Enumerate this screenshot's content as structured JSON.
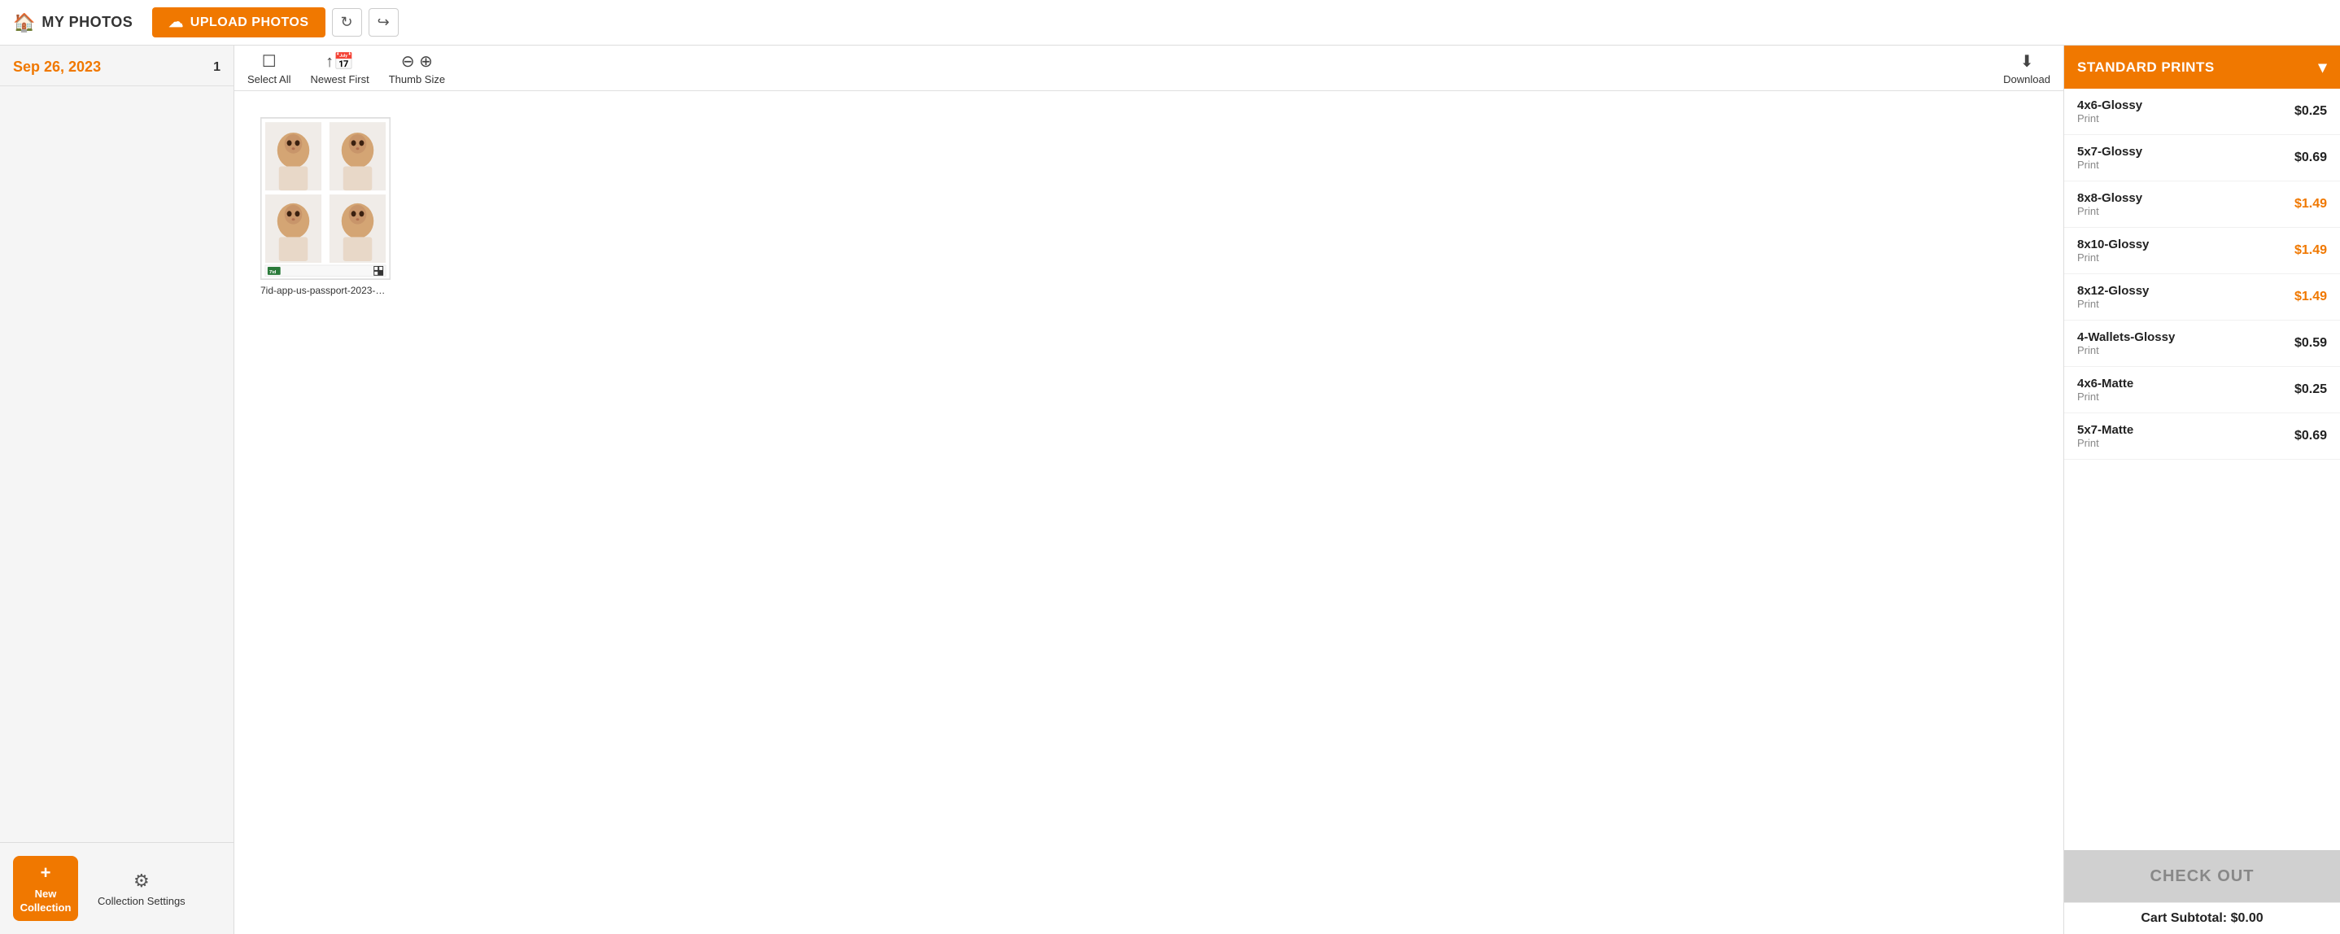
{
  "topbar": {
    "my_photos_label": "MY PHOTOS",
    "upload_btn_label": "UPLOAD PHOTOS",
    "refresh_icon": "↻",
    "share_icon": "↪"
  },
  "sidebar": {
    "date": "Sep 26, 2023",
    "count": "1",
    "new_collection_plus": "+",
    "new_collection_label": "New Collection",
    "collection_settings_label": "Collection Settings"
  },
  "toolbar": {
    "select_all_label": "Select All",
    "newest_first_label": "Newest First",
    "thumb_size_label": "Thumb Size",
    "download_label": "Download"
  },
  "photo": {
    "filename": "7id-app-us-passport-2023-09..."
  },
  "right_panel": {
    "standard_prints_label": "STANDARD PRINTS",
    "prints": [
      {
        "name": "4x6-Glossy",
        "type": "Print",
        "price": "$0.25",
        "highlight": false
      },
      {
        "name": "5x7-Glossy",
        "type": "Print",
        "price": "$0.69",
        "highlight": false
      },
      {
        "name": "8x8-Glossy",
        "type": "Print",
        "price": "$1.49",
        "highlight": true
      },
      {
        "name": "8x10-Glossy",
        "type": "Print",
        "price": "$1.49",
        "highlight": true
      },
      {
        "name": "8x12-Glossy",
        "type": "Print",
        "price": "$1.49",
        "highlight": true
      },
      {
        "name": "4-Wallets-Glossy",
        "type": "Print",
        "price": "$0.59",
        "highlight": false
      },
      {
        "name": "4x6-Matte",
        "type": "Print",
        "price": "$0.25",
        "highlight": false
      },
      {
        "name": "5x7-Matte",
        "type": "Print",
        "price": "$0.69",
        "highlight": false
      }
    ],
    "checkout_label": "CHECK OUT",
    "cart_subtotal_label": "Cart Subtotal: $0.00"
  }
}
